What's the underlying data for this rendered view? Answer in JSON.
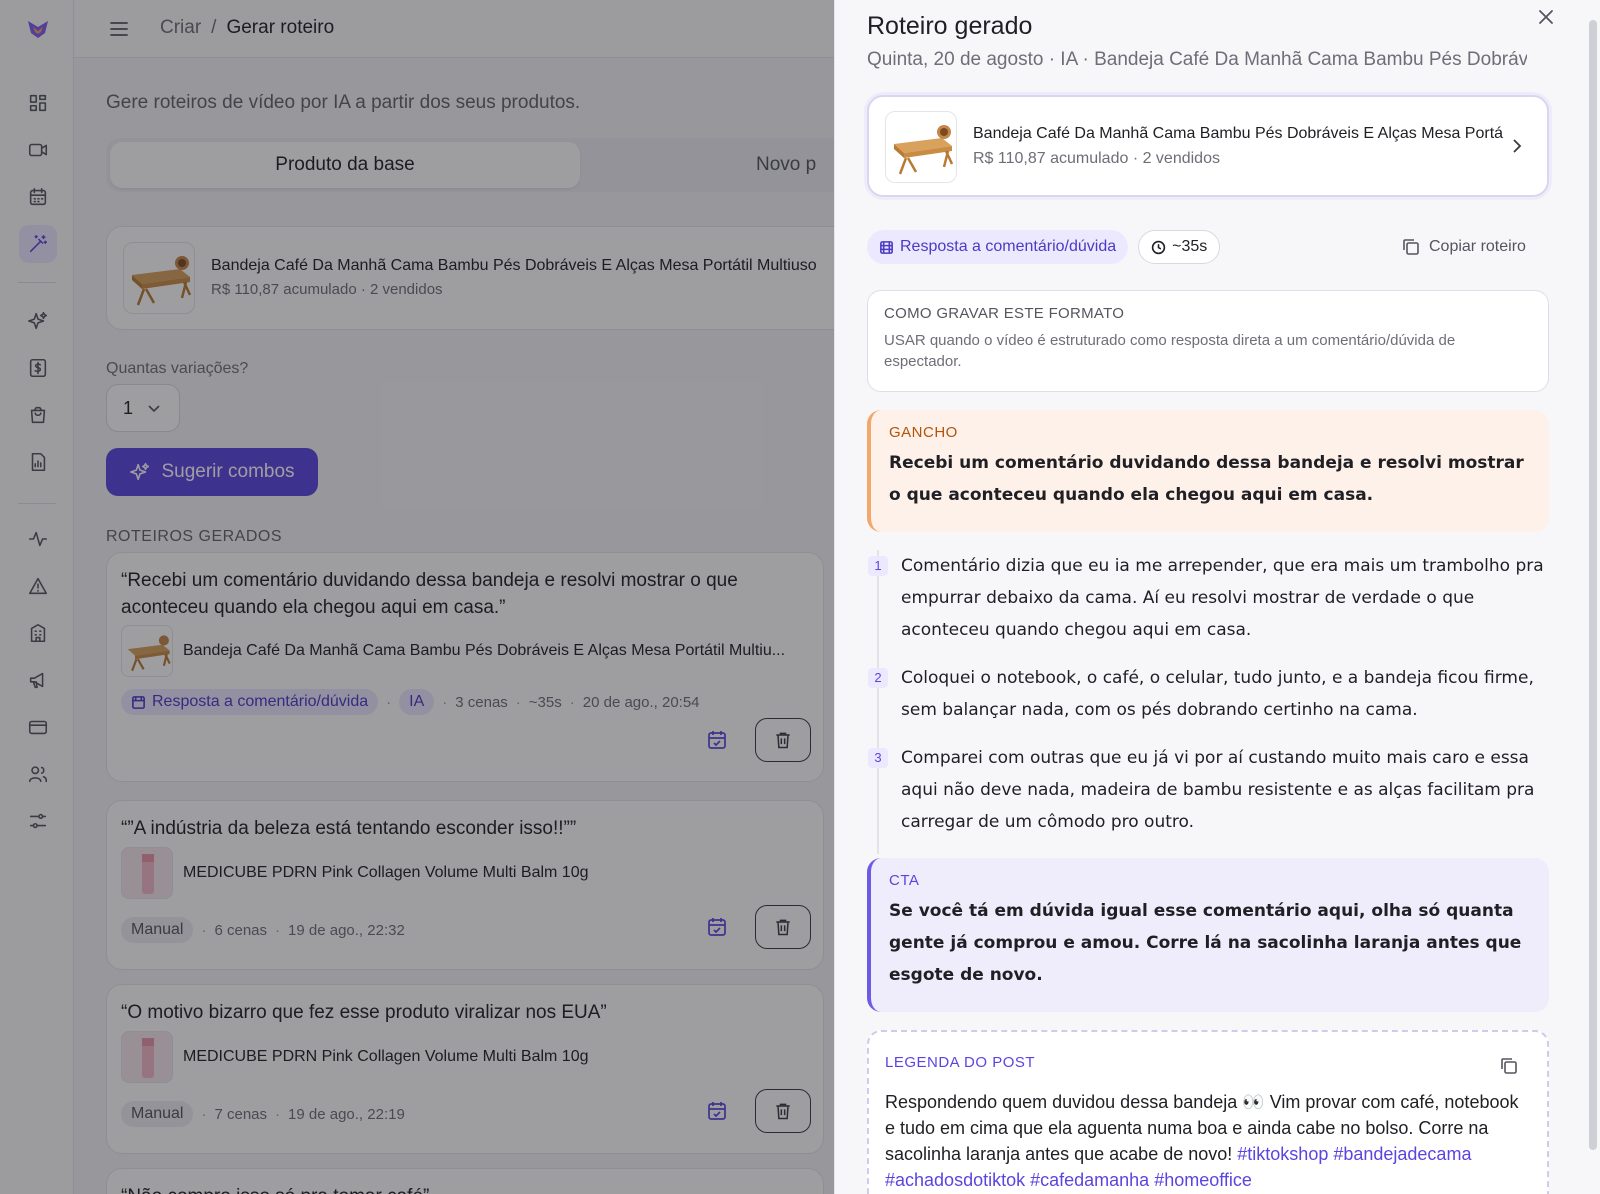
{
  "breadcrumb": {
    "parent": "Criar",
    "separator": "/",
    "current": "Gerar roteiro"
  },
  "intro": "Gere roteiros de vídeo por IA a partir dos seus produtos.",
  "tabs": {
    "active": "Produto da base",
    "other": "Novo p"
  },
  "product": {
    "title": "Bandeja Café Da Manhã Cama Bambu Pés Dobráveis E Alças Mesa Portátil Multiuso",
    "sub": "R$ 110,87 acumulado · 2 vendidos"
  },
  "variations": {
    "label": "Quantas variações?",
    "value": "1"
  },
  "suggest_button": "Sugerir combos",
  "section_title": "ROTEIROS GERADOS",
  "scripts": [
    {
      "title": "“Recebi um comentário duvidando dessa bandeja e resolvi mostrar o que aconteceu quando ela chegou aqui em casa.”",
      "product": "Bandeja Café Da Manhã Cama Bambu Pés Dobráveis E Alças Mesa Portátil Multiu...",
      "format": "Resposta a comentário/dúvida",
      "source": "IA",
      "scenes": "3 cenas",
      "duration": "~35s",
      "date": "20 de ago., 20:54"
    },
    {
      "title": "“”A indústria da beleza está tentando esconder isso!!””",
      "product": "MEDICUBE PDRN Pink Collagen Volume Multi Balm 10g",
      "source": "Manual",
      "scenes": "6 cenas",
      "date": "19 de ago., 22:32"
    },
    {
      "title": "“O motivo bizarro que fez esse produto viralizar nos EUA”",
      "product": "MEDICUBE PDRN Pink Collagen Volume Multi Balm 10g",
      "source": "Manual",
      "scenes": "7 cenas",
      "date": "19 de ago., 22:19"
    },
    {
      "title": "“Não compro isso só pra tomar café”"
    }
  ],
  "drawer": {
    "title": "Roteiro gerado",
    "subtitle": "Quinta, 20 de agosto · IA · Bandeja Café Da Manhã Cama Bambu Pés Dobráv...",
    "product_title": "Bandeja Café Da Manhã Cama Bambu Pés Dobráveis E Alças Mesa Portátil Multiuso",
    "product_sub": "R$ 110,87 acumulado · 2 vendidos",
    "format_chip": "Resposta a comentário/dúvida",
    "duration_chip": "~35s",
    "copy_label": "Copiar roteiro",
    "howto_title": "COMO GRAVAR ESTE FORMATO",
    "howto_body": "USAR quando o vídeo é estruturado como resposta direta a um comentário/dúvida de espectador.",
    "hook_label": "GANCHO",
    "hook_text": "Recebi um comentário duvidando dessa bandeja e resolvi mostrar o que aconteceu quando ela chegou aqui em casa.",
    "steps": [
      {
        "n": "1",
        "text": "Comentário dizia que eu ia me arrepender, que era mais um trambolho pra empurrar debaixo da cama. Aí eu resolvi mostrar de verdade o que aconteceu quando chegou aqui em casa."
      },
      {
        "n": "2",
        "text": "Coloquei o notebook, o café, o celular, tudo junto, e a bandeja ficou firme, sem balançar nada, com os pés dobrando certinho na cama."
      },
      {
        "n": "3",
        "text": "Comparei com outras que eu já vi por aí custando muito mais caro e essa aqui não deve nada, madeira de bambu resistente e as alças facilitam pra carregar de um cômodo pro outro."
      }
    ],
    "cta_label": "CTA",
    "cta_text": "Se você tá em dúvida igual esse comentário aqui, olha só quanta gente já comprou e amou. Corre lá na sacolinha laranja antes que esgote de novo.",
    "caption_label": "LEGENDA DO POST",
    "caption_text": "Respondendo quem duvidou dessa bandeja 👀 Vim provar com café, notebook e tudo em cima que ela aguenta numa boa e ainda cabe no bolso. Corre na sacolinha laranja antes que acabe de novo!",
    "caption_tags": "#tiktokshop #bandejadecama #achadosdotiktok #cafedamanha #homeoffice"
  },
  "colors": {
    "accent": "#5b45e0",
    "hook_bg": "#fdf1ea",
    "cta_bg": "#efedfb"
  }
}
